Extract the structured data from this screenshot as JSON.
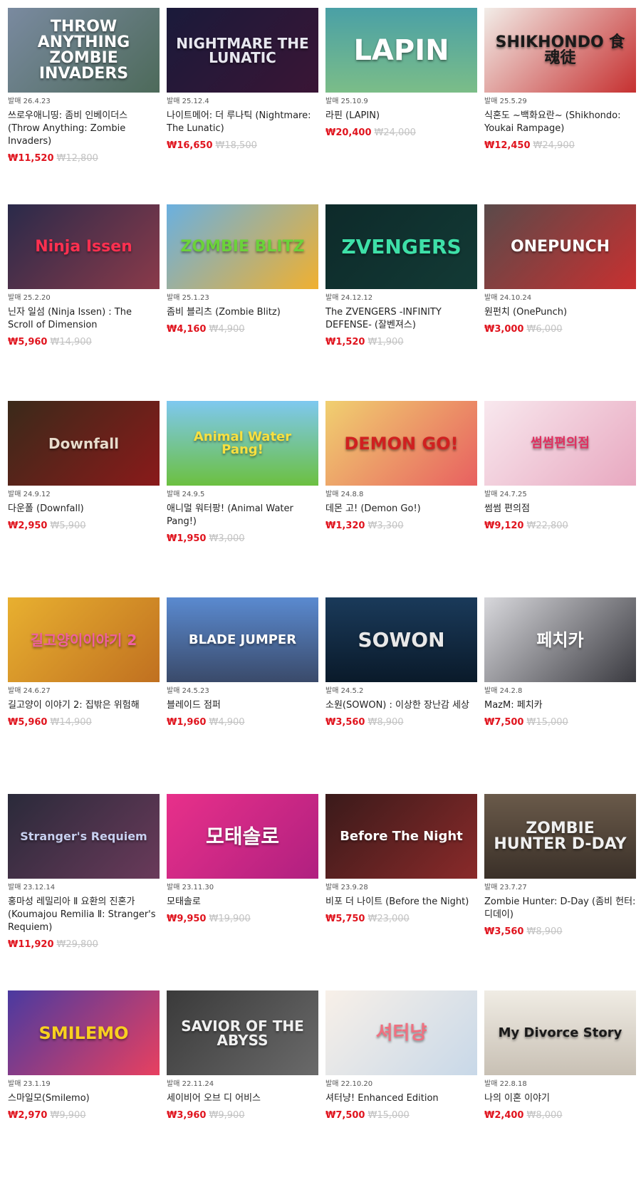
{
  "colors": {
    "sale": "#e0141e",
    "original": "#c3c3c3"
  },
  "rows": [
    [
      {
        "logo": "THROW ANYTHING ZOMBIE INVADERS",
        "bg": "linear-gradient(135deg,#7a8aa0,#4d6a5a)",
        "fg": "#ffffff",
        "fs": 22,
        "release": "발매 26.4.23",
        "title": "쓰로우애니띵: 좀비 인베이더스 (Throw Anything: Zombie Invaders)",
        "sale": "₩11,520",
        "orig": "₩12,800"
      },
      {
        "logo": "NIGHTMARE THE LUNATIC",
        "bg": "linear-gradient(135deg,#1a1a3a,#3a1535)",
        "fg": "#e8e8f0",
        "fs": 20,
        "release": "발매 25.12.4",
        "title": "나이트메어: 더 루나틱 (Nightmare: The Lunatic)",
        "sale": "₩16,650",
        "orig": "₩18,500"
      },
      {
        "logo": "LAPIN",
        "bg": "linear-gradient(180deg,#4aa0a6,#7bbd88)",
        "fg": "#ffffff",
        "fs": 40,
        "release": "발매 25.10.9",
        "title": "라핀 (LAPIN)",
        "sale": "₩20,400",
        "orig": "₩24,000"
      },
      {
        "logo": "SHIKHONDO 食魂徒",
        "bg": "linear-gradient(135deg,#f2ede8,#c63030)",
        "fg": "#1a1a1a",
        "fs": 22,
        "release": "발매 25.5.29",
        "title": "식혼도 ~백화요란~ (Shikhondo: Youkai Rampage)",
        "sale": "₩12,450",
        "orig": "₩24,900"
      }
    ],
    [
      {
        "logo": "Ninja Issen",
        "bg": "linear-gradient(135deg,#2a2a4a,#8a3a4a)",
        "fg": "#ff3050",
        "fs": 22,
        "release": "발매 25.2.20",
        "title": "닌자 일섬 (Ninja Issen) : The Scroll of Dimension",
        "sale": "₩5,960",
        "orig": "₩14,900"
      },
      {
        "logo": "ZOMBIE BLITZ",
        "bg": "linear-gradient(135deg,#6ab0e0,#f0b030)",
        "fg": "#6bd23a",
        "fs": 22,
        "release": "발매 25.1.23",
        "title": "좀비 블리츠 (Zombie Blitz)",
        "sale": "₩4,160",
        "orig": "₩4,900"
      },
      {
        "logo": "ZVENGERS",
        "bg": "linear-gradient(135deg,#0d2a2a,#133a35)",
        "fg": "#3ee0a8",
        "fs": 28,
        "release": "발매 24.12.12",
        "title": "The ZVENGERS -INFINITY DEFENSE- (잘벤져스)",
        "sale": "₩1,520",
        "orig": "₩1,900"
      },
      {
        "logo": "ONEPUNCH",
        "bg": "linear-gradient(135deg,#5a4a4a,#c83030)",
        "fg": "#ffffff",
        "fs": 22,
        "release": "발매 24.10.24",
        "title": "원펀치 (OnePunch)",
        "sale": "₩3,000",
        "orig": "₩6,000"
      }
    ],
    [
      {
        "logo": "Downfall",
        "bg": "linear-gradient(135deg,#3a2a1a,#8a1a1a)",
        "fg": "#e8dccc",
        "fs": 20,
        "release": "발매 24.9.12",
        "title": "다운폴 (Downfall)",
        "sale": "₩2,950",
        "orig": "₩5,900"
      },
      {
        "logo": "Animal Water Pang!",
        "bg": "linear-gradient(180deg,#7ec8f0,#6cc040)",
        "fg": "#f8e040",
        "fs": 18,
        "release": "발매 24.9.5",
        "title": "애니멀 워터팡! (Animal Water Pang!)",
        "sale": "₩1,950",
        "orig": "₩3,000"
      },
      {
        "logo": "DEMON GO!",
        "bg": "linear-gradient(135deg,#f0d070,#e86060)",
        "fg": "#d02020",
        "fs": 24,
        "release": "발매 24.8.8",
        "title": "데몬 고! (Demon Go!)",
        "sale": "₩1,320",
        "orig": "₩3,300"
      },
      {
        "logo": "썸썸편의점",
        "bg": "linear-gradient(135deg,#f8e8ee,#e8a8c0)",
        "fg": "#e03060",
        "fs": 18,
        "release": "발매 24.7.25",
        "title": "썸썸 편의점",
        "sale": "₩9,120",
        "orig": "₩22,800"
      }
    ],
    [
      {
        "logo": "길고양이이야기 2",
        "bg": "linear-gradient(135deg,#e8b030,#c07020)",
        "fg": "#f060a0",
        "fs": 20,
        "release": "발매 24.6.27",
        "title": "길고양이 이야기 2: 집밖은 위험해",
        "sale": "₩5,960",
        "orig": "₩14,900"
      },
      {
        "logo": "BLADE JUMPER",
        "bg": "linear-gradient(180deg,#5a8ad0,#3a4a6a)",
        "fg": "#ffffff",
        "fs": 18,
        "release": "발매 24.5.23",
        "title": "블레이드 점퍼",
        "sale": "₩1,960",
        "orig": "₩4,900"
      },
      {
        "logo": "SOWON",
        "bg": "linear-gradient(180deg,#1a3a5a,#0a1a2a)",
        "fg": "#e8e8e8",
        "fs": 28,
        "release": "발매 24.5.2",
        "title": "소원(SOWON) : 이상한 장난감 세상",
        "sale": "₩3,560",
        "orig": "₩8,900"
      },
      {
        "logo": "페치카",
        "bg": "linear-gradient(135deg,#d8d8dc,#3a3a40)",
        "fg": "#ffffff",
        "fs": 24,
        "release": "발매 24.2.8",
        "title": "MazM: 페치카",
        "sale": "₩7,500",
        "orig": "₩15,000"
      }
    ],
    [
      {
        "logo": "Stranger's Requiem",
        "bg": "linear-gradient(135deg,#2a2a3a,#6a3a5a)",
        "fg": "#c8d0f0",
        "fs": 16,
        "release": "발매 23.12.14",
        "title": "홍마성 레밀리아 Ⅱ 요환의 진혼가 (Koumajou Remilia Ⅱ: Stranger's Requiem)",
        "sale": "₩11,920",
        "orig": "₩29,800"
      },
      {
        "logo": "모태솔로",
        "bg": "linear-gradient(135deg,#e8308a,#b02080)",
        "fg": "#ffffff",
        "fs": 28,
        "release": "발매 23.11.30",
        "title": "모태솔로",
        "sale": "₩9,950",
        "orig": "₩19,900"
      },
      {
        "logo": "Before The Night",
        "bg": "linear-gradient(135deg,#3a1a1a,#8a2a2a)",
        "fg": "#ffffff",
        "fs": 18,
        "release": "발매 23.9.28",
        "title": "비포 더 나이트 (Before the Night)",
        "sale": "₩5,750",
        "orig": "₩23,000"
      },
      {
        "logo": "ZOMBIE HUNTER D-DAY",
        "bg": "linear-gradient(180deg,#6a5a4a,#3a3028)",
        "fg": "#f0f0f0",
        "fs": 22,
        "release": "발매 23.7.27",
        "title": "Zombie Hunter: D-Day (좀비 헌터: 디데이)",
        "sale": "₩3,560",
        "orig": "₩8,900"
      }
    ],
    [
      {
        "logo": "SMILEMO",
        "bg": "linear-gradient(135deg,#4a3aa0,#e84060)",
        "fg": "#f8d020",
        "fs": 24,
        "release": "발매 23.1.19",
        "title": "스마일모(Smilemo)",
        "sale": "₩2,970",
        "orig": "₩9,900"
      },
      {
        "logo": "SAVIOR OF THE ABYSS",
        "bg": "linear-gradient(135deg,#3a3a3a,#6a6a6a)",
        "fg": "#f0f0f0",
        "fs": 20,
        "release": "발매 22.11.24",
        "title": "세이비어 오브 디 어비스",
        "sale": "₩3,960",
        "orig": "₩9,900"
      },
      {
        "logo": "셔터냥",
        "bg": "linear-gradient(135deg,#f8f0e8,#c8d8e8)",
        "fg": "#f07080",
        "fs": 26,
        "release": "발매 22.10.20",
        "title": "셔터냥! Enhanced Edition",
        "sale": "₩7,500",
        "orig": "₩15,000"
      },
      {
        "logo": "My Divorce Story",
        "bg": "linear-gradient(180deg,#f0ece4,#c8c0b4)",
        "fg": "#1a1a1a",
        "fs": 18,
        "release": "발매 22.8.18",
        "title": "나의 이혼 이야기",
        "sale": "₩2,400",
        "orig": "₩8,000"
      }
    ]
  ]
}
